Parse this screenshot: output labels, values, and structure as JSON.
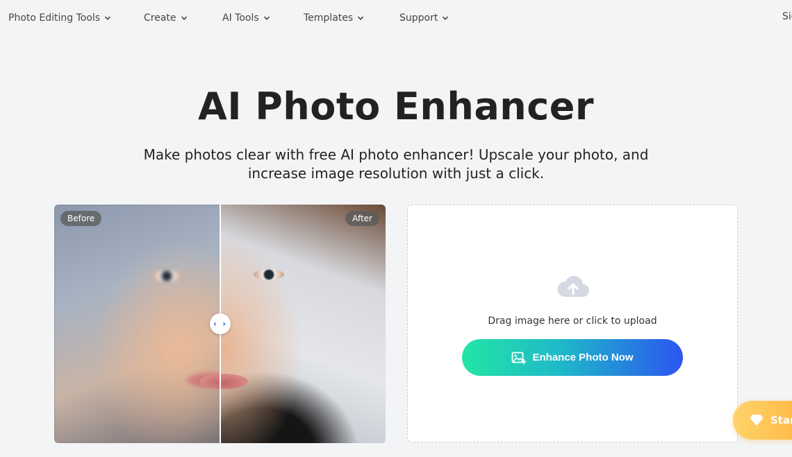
{
  "nav": {
    "items": [
      {
        "label": "Photo Editing Tools"
      },
      {
        "label": "Create"
      },
      {
        "label": "AI Tools"
      },
      {
        "label": "Templates"
      },
      {
        "label": "Support"
      }
    ],
    "signin_label": "Sig"
  },
  "hero": {
    "title": "AI Photo Enhancer",
    "subtitle": "Make photos clear with free AI photo enhancer! Upscale your photo, and increase image resolution with just a click."
  },
  "compare": {
    "before_label": "Before",
    "after_label": "After",
    "handle_icon": "left-right-arrows-icon",
    "handle_text": "‹ ›"
  },
  "upload": {
    "icon": "cloud-upload-icon",
    "prompt": "Drag image here or click to upload",
    "button_label": "Enhance Photo Now",
    "button_icon": "image-add-icon"
  },
  "floating": {
    "label": "Star",
    "icon": "diamond-icon"
  },
  "colors": {
    "background": "#f3f4f6",
    "button_gradient_start": "#23e6a4",
    "button_gradient_end": "#2b55f0",
    "floating_gradient": "#ffb43c"
  }
}
